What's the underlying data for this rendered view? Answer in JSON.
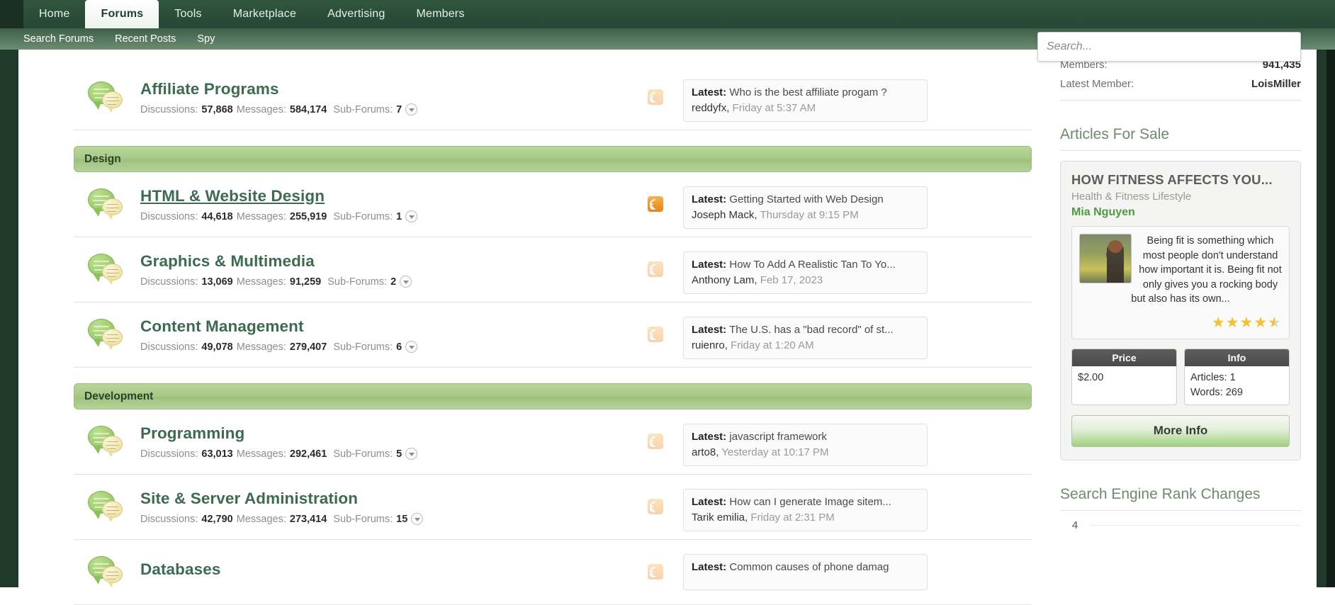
{
  "nav": {
    "tabs": [
      {
        "label": "Home",
        "active": false
      },
      {
        "label": "Forums",
        "active": true
      },
      {
        "label": "Tools",
        "active": false
      },
      {
        "label": "Marketplace",
        "active": false
      },
      {
        "label": "Advertising",
        "active": false
      },
      {
        "label": "Members",
        "active": false
      }
    ],
    "sub_items": [
      "Search Forums",
      "Recent Posts",
      "Spy"
    ]
  },
  "search": {
    "placeholder": "Search...",
    "value": ""
  },
  "labels": {
    "discussions": "Discussions:",
    "messages": "Messages:",
    "subforums": "Sub-Forums:",
    "latest": "Latest:"
  },
  "forums": [
    {
      "type": "forum",
      "name": "Affiliate Programs",
      "linked": false,
      "discussions": "57,868",
      "messages": "584,174",
      "subforums": "7",
      "rss_bright": false,
      "latest_title": "Who is the best affiliate progam ?",
      "latest_author": "reddyfx",
      "latest_date": "Friday at 5:37 AM"
    },
    {
      "type": "category",
      "name": "Design"
    },
    {
      "type": "forum",
      "name": "HTML & Website Design",
      "linked": true,
      "discussions": "44,618",
      "messages": "255,919",
      "subforums": "1",
      "rss_bright": true,
      "latest_title": "Getting Started with Web Design",
      "latest_author": "Joseph Mack",
      "latest_date": "Thursday at 9:15 PM"
    },
    {
      "type": "forum",
      "name": "Graphics & Multimedia",
      "linked": false,
      "discussions": "13,069",
      "messages": "91,259",
      "subforums": "2",
      "rss_bright": false,
      "latest_title": "How To Add A Realistic Tan To Yo...",
      "latest_author": "Anthony Lam",
      "latest_date": "Feb 17, 2023"
    },
    {
      "type": "forum",
      "name": "Content Management",
      "linked": false,
      "discussions": "49,078",
      "messages": "279,407",
      "subforums": "6",
      "rss_bright": false,
      "latest_title": "The U.S. has a \"bad record\" of st...",
      "latest_author": "ruienro",
      "latest_date": "Friday at 1:20 AM"
    },
    {
      "type": "category",
      "name": "Development"
    },
    {
      "type": "forum",
      "name": "Programming",
      "linked": false,
      "discussions": "63,013",
      "messages": "292,461",
      "subforums": "5",
      "rss_bright": false,
      "latest_title": "javascript framework",
      "latest_author": "arto8",
      "latest_date": "Yesterday at 10:17 PM"
    },
    {
      "type": "forum",
      "name": "Site & Server Administration",
      "linked": false,
      "discussions": "42,790",
      "messages": "273,414",
      "subforums": "15",
      "rss_bright": false,
      "latest_title": "How can I generate Image sitem...",
      "latest_author": "Tarik emilia",
      "latest_date": "Friday at 2:31 PM"
    },
    {
      "type": "forum",
      "name": "Databases",
      "linked": false,
      "discussions": "",
      "messages": "",
      "subforums": "",
      "rss_bright": false,
      "latest_title": "Common causes of phone damag",
      "latest_author": "",
      "latest_date": ""
    }
  ],
  "sidebar": {
    "stats": [
      {
        "label": "Members:",
        "value": "941,435"
      },
      {
        "label": "Latest Member:",
        "value": "LoisMiller"
      }
    ],
    "articles_heading": "Articles For Sale",
    "article": {
      "title": "HOW FITNESS AFFECTS YOU...",
      "category": "Health & Fitness Lifestyle",
      "author": "Mia Nguyen",
      "snippet": "Being fit is something which most people don't understand how important it is. Being fit not only gives you a rocking body but also has its own...",
      "rating": 4.5,
      "price_header": "Price",
      "price_value": "$2.00",
      "info_header": "Info",
      "info_articles": "Articles: 1",
      "info_words": "Words: 269",
      "more_info_label": "More Info"
    },
    "rank_heading": "Search Engine Rank Changes",
    "rank_first_value": "4"
  }
}
